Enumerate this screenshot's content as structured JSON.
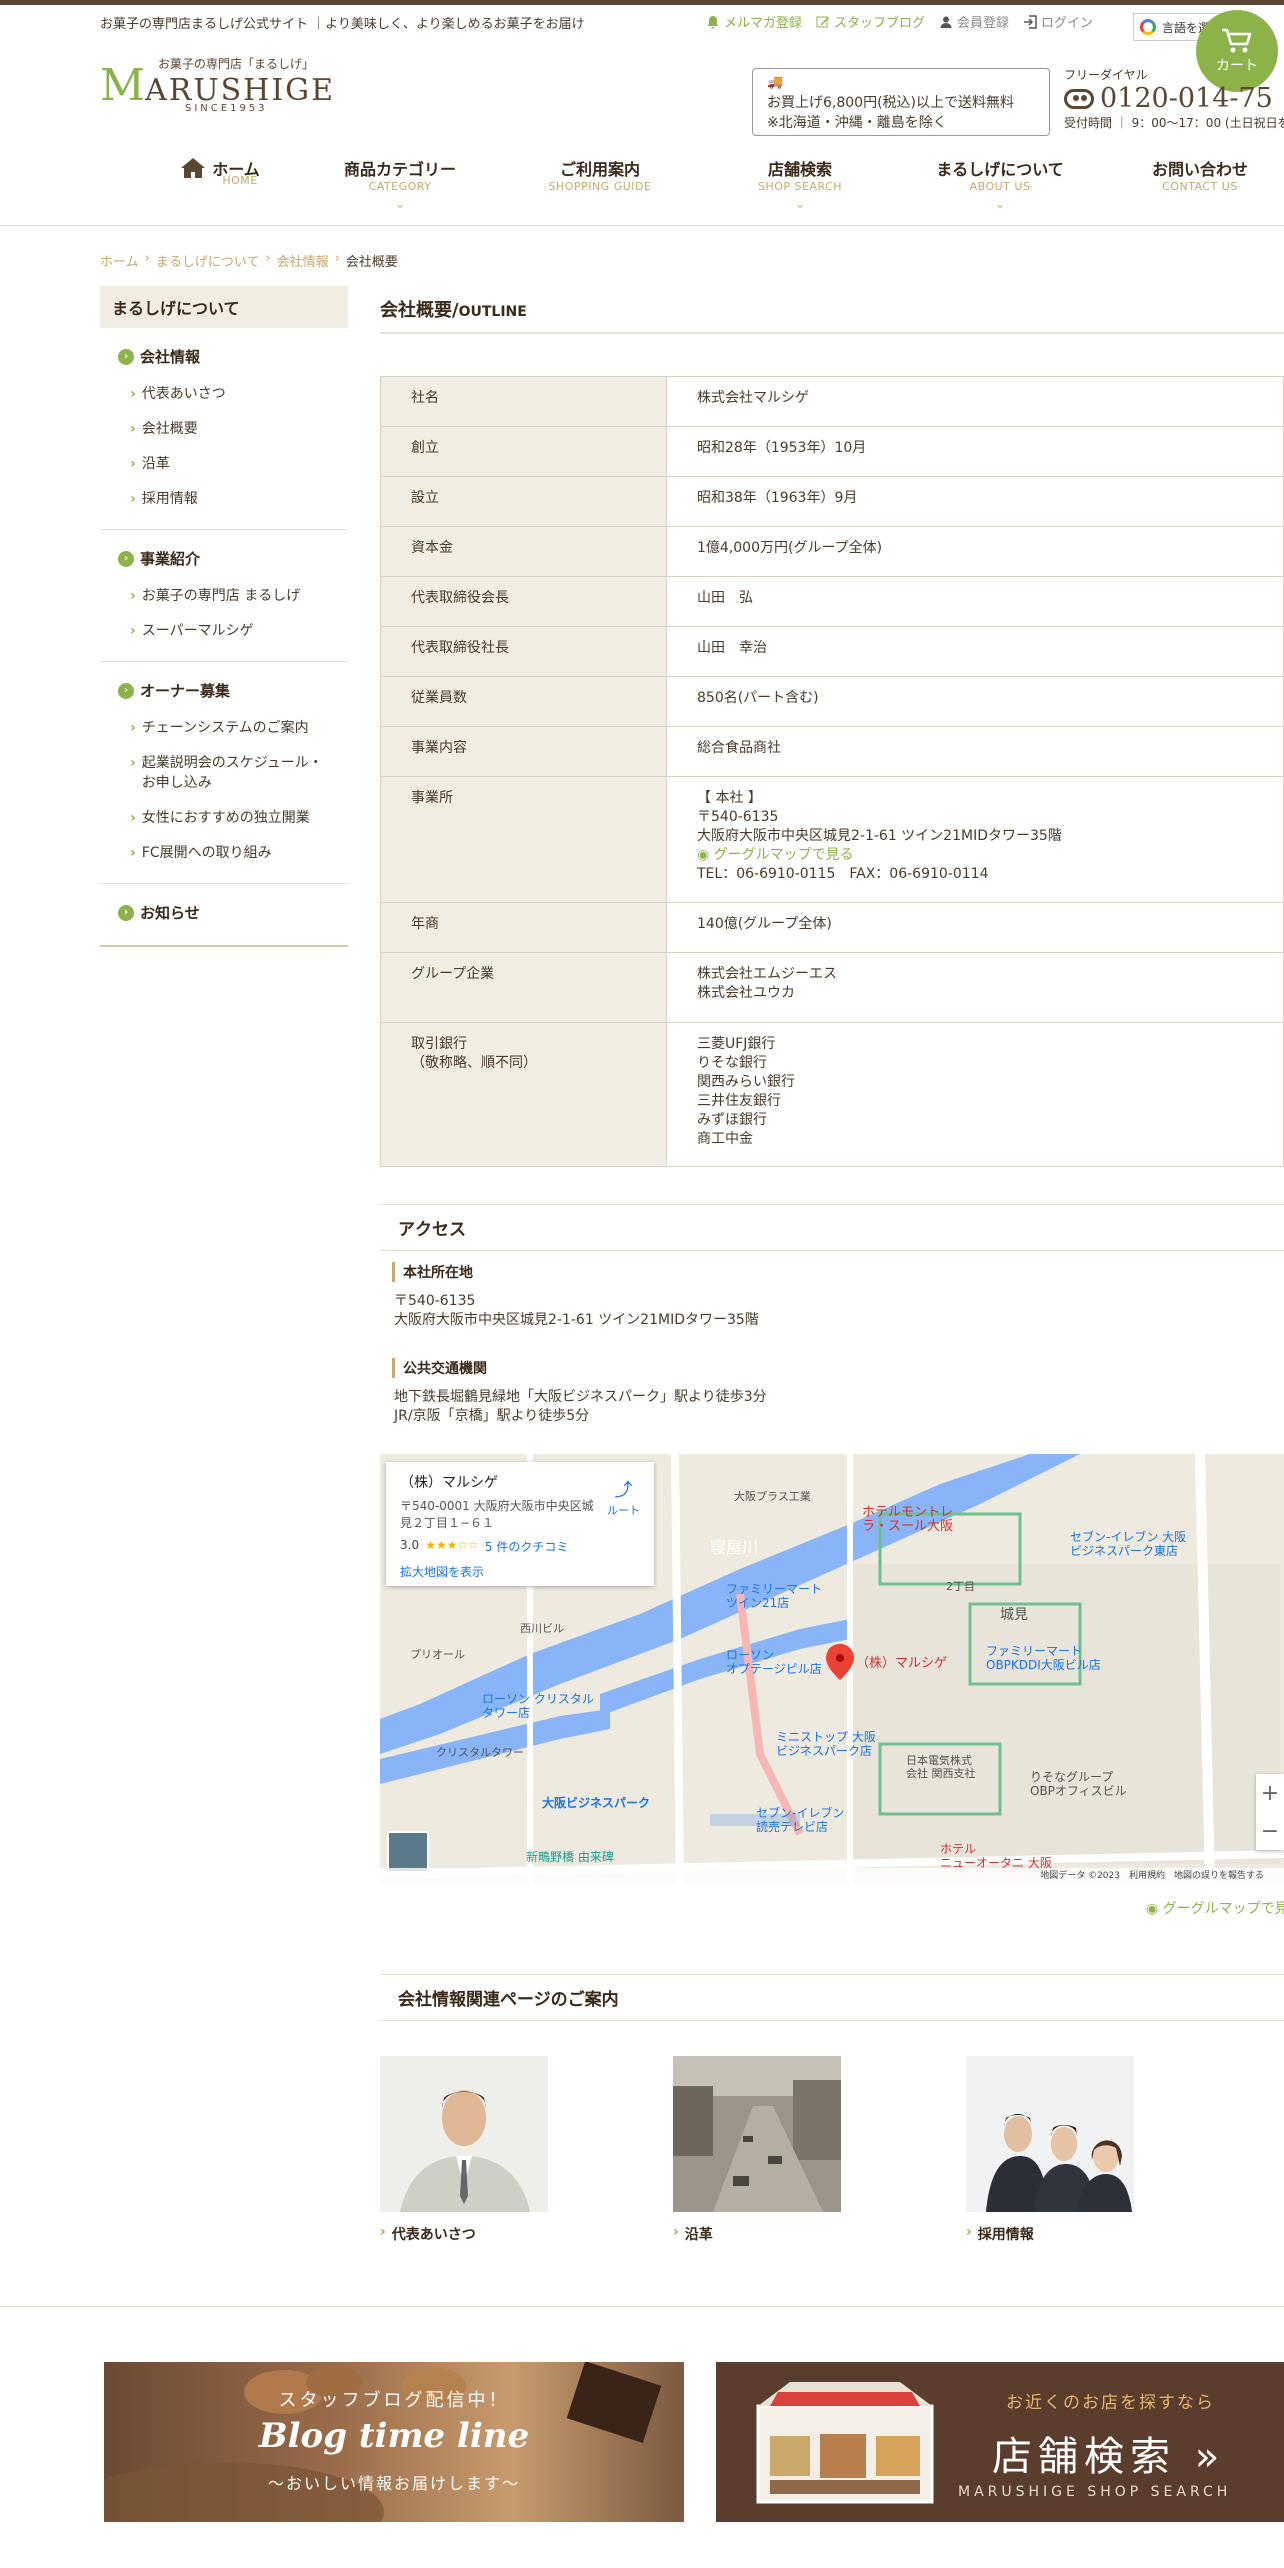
{
  "header": {
    "tagline": "お菓子の専門店まるしげ公式サイト ｜より美味しく、より楽しめるお菓子をお届け",
    "util_links": [
      {
        "label": "メルマガ登録",
        "icon": "bell-icon"
      },
      {
        "label": "スタッフブログ",
        "icon": "pencil-icon"
      },
      {
        "label": "会員登録",
        "icon": "person-icon"
      },
      {
        "label": "ログイン",
        "icon": "login-icon"
      }
    ],
    "language_label": "言語を選",
    "cart_label": "カート",
    "logo": {
      "small": "お菓子の専門店「まるしげ」",
      "big_initial": "M",
      "big_rest": "ARUSHIGE",
      "since": "SINCE1953"
    },
    "shipping_notice": {
      "line1": "お買上げ6,800円(税込)以上で送料無料",
      "line2": "※北海道・沖縄・離島を除く"
    },
    "free_dial": {
      "label": "フリーダイヤル",
      "number": "0120-014-75",
      "hours": "受付時間 ｜ 9：00〜17：00 (土日祝日を除"
    }
  },
  "nav": [
    {
      "ja": "ホーム",
      "en": "HOME",
      "icon": "home-icon"
    },
    {
      "ja": "商品カテゴリー",
      "en": "CATEGORY",
      "has_dropdown": true
    },
    {
      "ja": "ご利用案内",
      "en": "SHOPPING GUIDE"
    },
    {
      "ja": "店舗検索",
      "en": "SHOP SEARCH",
      "has_dropdown": true
    },
    {
      "ja": "まるしげについて",
      "en": "ABOUT US",
      "has_dropdown": true
    },
    {
      "ja": "お問い合わせ",
      "en": "CONTACT US"
    }
  ],
  "breadcrumb": [
    "ホーム",
    "まるしげについて",
    "会社情報",
    "会社概要"
  ],
  "sidebar": {
    "title": "まるしげについて",
    "groups": [
      {
        "title": "会社情報",
        "items": [
          "代表あいさつ",
          "会社概要",
          "沿革",
          "採用情報"
        ]
      },
      {
        "title": "事業紹介",
        "items": [
          "お菓子の専門店 まるしげ",
          "スーパーマルシゲ"
        ]
      },
      {
        "title": "オーナー募集",
        "items": [
          "チェーンシステムのご案内",
          "起業説明会のスケジュール・",
          "お申し込み",
          "女性におすすめの独立開業",
          "FC展開への取り組み"
        ]
      },
      {
        "title": "お知らせ",
        "items": []
      }
    ]
  },
  "main": {
    "title": "会社概要/",
    "title_en": "OUTLINE",
    "outline": [
      {
        "label": "社名",
        "value": "株式会社マルシゲ"
      },
      {
        "label": "創立",
        "value": "昭和28年（1953年）10月"
      },
      {
        "label": "設立",
        "value": "昭和38年（1963年）9月"
      },
      {
        "label": "資本金",
        "value": "1億4,000万円(グループ全体)"
      },
      {
        "label": "代表取締役会長",
        "value": "山田　弘"
      },
      {
        "label": "代表取締役社長",
        "value": "山田　幸治"
      },
      {
        "label": "従業員数",
        "value": "850名(パート含む)"
      },
      {
        "label": "事業内容",
        "value": "総合食品商社"
      },
      {
        "label": "事業所",
        "office_head": "【 本社 】",
        "postal": "〒540-6135",
        "address": "大阪府大阪市中央区城見2-1-61 ツイン21MIDタワー35階",
        "map_link": "グーグルマップで見る",
        "tel": "TEL：06-6910-0115　FAX：06-6910-0114"
      },
      {
        "label": "年商",
        "value": "140億(グループ全体)"
      },
      {
        "label": "グループ企業",
        "lines": [
          "株式会社エムジーエス",
          "株式会社ユウカ"
        ]
      },
      {
        "label": "取引銀行",
        "label2": "（敬称略、順不同）",
        "lines": [
          "三菱UFJ銀行",
          "りそな銀行",
          "関西みらい銀行",
          "三井住友銀行",
          "みずほ銀行",
          "商工中金"
        ]
      }
    ]
  },
  "access": {
    "title": "アクセス",
    "hq_title": "本社所在地",
    "hq_postal": "〒540-6135",
    "hq_address": "大阪府大阪市中央区城見2-1-61 ツイン21MIDタワー35階",
    "transit_title": "公共交通機関",
    "transit_1": "地下鉄長堀鶴見緑地「大阪ビジネスパーク」駅より徒歩3分",
    "transit_2": "JR/京阪「京橋」駅より徒歩5分",
    "map": {
      "card_name": "（株）マルシゲ",
      "card_address": "〒540-0001 大阪府大阪市中央区城見２丁目１−６１",
      "card_rating": "3.0",
      "card_stars": "★★★☆☆",
      "card_reviews": "5 件のクチコミ",
      "card_route": "ルート",
      "card_enlarge": "拡大地図を表示",
      "pin_label": "（株）マルシゲ",
      "labels": {
        "hotel_monterey": "ホテルモントレ\nラ・スール大阪",
        "seven_eleven": "セブン-イレブン 大阪\nビジネスパーク東店",
        "familymart_twin": "ファミリーマート\nツイン21店",
        "familymart_obp": "ファミリーマート\nOBPKDDI大阪ビル店",
        "lawson": "ローソン\nオプテージビル店",
        "lawson_crystal": "ローソン クリスタル\nタワー店",
        "crystal_tower": "クリスタルタワー",
        "osaka_bp": "大阪ビジネスパーク",
        "ministop": "ミニストップ 大阪\nビジネスパーク店",
        "nec": "日本電気株式\n会社 関西支社",
        "seven_yomiuri": "セブン-イレブン\n読売テレビ店",
        "risona_obp": "りそなグループ\nOBPオフィスビル",
        "new_otani": "ホテル\nニューオータニ 大阪",
        "neyagawa": "寝屋川",
        "shirokita": "城見",
        "nichome": "2丁目",
        "yurakuen": "新鴫野橋 由来碑",
        "prior": "プリオール",
        "osaka_plus": "大阪プラス工業",
        "nishizume": "西川ビル",
        "footer": "地図データ ©2023　利用規約　地図の誤りを報告する"
      }
    },
    "google_map_link": "グーグルマップで見"
  },
  "related": {
    "title": "会社情報関連ページのご案内",
    "cards": [
      {
        "label": "代表あいさつ",
        "image": "president-portrait"
      },
      {
        "label": "沿革",
        "image": "historic-street-photo"
      },
      {
        "label": "採用情報",
        "image": "staff-group-photo"
      }
    ]
  },
  "banners": {
    "blog": {
      "line1": "スタッフブログ配信中！",
      "line2": "Blog time line",
      "line3": "〜おいしい情報お届けします〜"
    },
    "shop": {
      "line1": "お近くのお店を探すなら",
      "line2": "店舗検索 »",
      "line3": "MARUSHIGE SHOP SEARCH"
    }
  },
  "colors": {
    "accent_green": "#8db24a",
    "brown": "#5a4632",
    "gold": "#c9a86a",
    "table_header_bg": "#f2ede3"
  }
}
